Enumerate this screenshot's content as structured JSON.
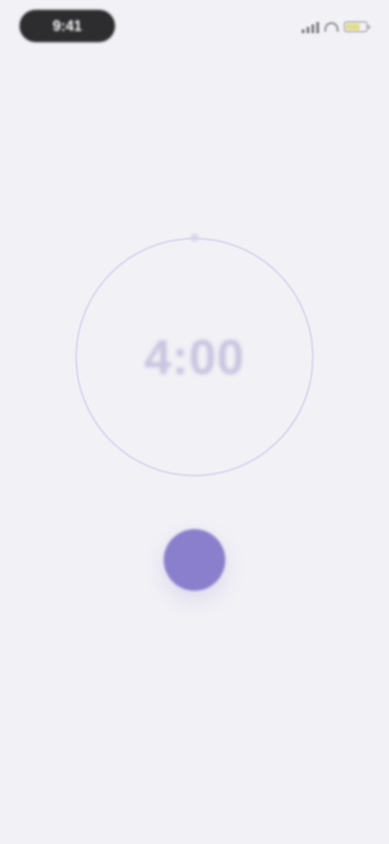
{
  "status_bar": {
    "time": "9:41",
    "icons": [
      "signal-icon",
      "wifi-icon",
      "battery-icon"
    ],
    "battery_level": 0.7,
    "battery_color": "#e3dd8a"
  },
  "timer": {
    "display": "4:00",
    "progress": 1.0,
    "ring_color": "#e0ddef",
    "text_color": "#c9c4df"
  },
  "controls": {
    "start_button_color": "#8a7fcc",
    "start_icon": "play-icon"
  },
  "colors": {
    "background": "#f2f1f6",
    "accent": "#8a7fcc"
  }
}
